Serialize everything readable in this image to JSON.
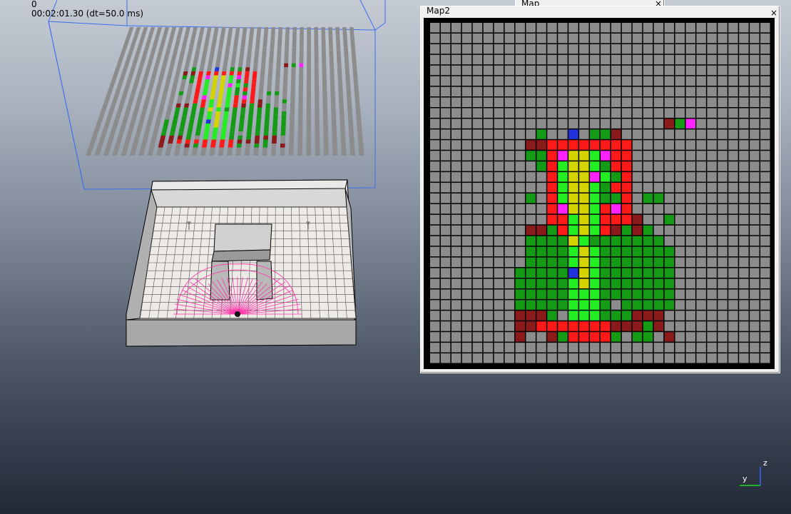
{
  "hud": {
    "frame": "0",
    "time": "00:02:01.30 (dt=50.0 ms)"
  },
  "windows": {
    "map": {
      "title": "Map",
      "close_label": "×"
    },
    "map2": {
      "title": "Map2",
      "close_label": "×"
    }
  },
  "axes_gizmo": {
    "y_label": "y",
    "z_label": "z"
  },
  "colors": {
    "unknown": "#8c8c8c",
    "darkred": "#8b1a1a",
    "red": "#ff1a1a",
    "orange": "#ff8c00",
    "yellow": "#d4d400",
    "lime": "#22ee22",
    "green": "#159a15",
    "blue": "#2233dd",
    "magenta": "#ff22ff",
    "grid_line": "#000000",
    "bounding_box": "#3a6ff0",
    "laser": "#ff33aa"
  },
  "map2": {
    "size": 32,
    "legend": {
      "u": "unknown",
      "d": "darkred",
      "r": "red",
      "o": "orange",
      "y": "yellow",
      "l": "lime",
      "g": "green",
      "b": "blue",
      "m": "magenta"
    },
    "rows": [
      "uuuuuuuuuuuuuuuuuuuuuuuuuuuuuuuu",
      "uuuuuuuuuuuuuuuuuuuuuuuuuuuuuuuu",
      "uuuuuuuuuuuuuuuuuuuuuuuuuuuuuuuu",
      "uuuuuuuuuuuuuuuuuuuuuuuuuuuuuuuu",
      "uuuuuuuuuuuuuuuuuuuuuuuuuuuuuuuu",
      "uuuuuuuuuuuuuuuuuuuuuuuuuuuuuuuu",
      "uuuuuuuuuuuuuuuuuuuuuuuuuuuuuuuu",
      "uuuuuuuuuuuuuuuuuuuuuuuuuuuuuuuu",
      "uuuuuuuuuuuuuuuuuuuuuuuuuuuuuuuu",
      "uuuuuuuuuuuuuuuuuuuuuudgmuuuuuuu",
      "uuuuuuuuuuguubuggduuuuuuuuuuuuuu",
      "uuuuuuuuuddrrrrrrrruuuuuuuuuuuuu",
      "uuuuuuuuuggrmyylmrruuuuuuuuuuuuu",
      "uuuuuuuuuugrlyylgrruuuuuuuuuuuuu",
      "uuuuuuuuuuurlyymlgruuuuuuuuuuuuu",
      "uuuuuuuuuuurlyylgrruuuuuuuuuuuuu",
      "uuuuuuuuugurlyylggrugguuuuuuuuuu",
      "uuuuuuuuuuurmyylrmruuuuuuuuuuuuu",
      "uuuuuuuuuuurrlylrrrduuguuuuuuuuu",
      "uuuuuuuuuddgrlylrdgdguuuuuuuuuuu",
      "uuuuuuuuuggggylggggggguuuuuuuuuu",
      "uuuuuuuuugggglylggggggguuuuuuuuu",
      "uuuuuuuuugggglylggggggguuuuuuuuu",
      "uuuuuuuugggggbylggggggguuuuuuuuu",
      "uuuuuuuuggggglylggggggguuuuuuuuu",
      "uuuuuuuuggggglllggggggguuuuuuuuu",
      "uuuuuuuuggggglllguggggguuuuuuuuu",
      "uuuuuuuudddgulllgggddduuuuuuuuuu",
      "uuuuuuuuddrrrrrrrdddgduuuuuuuuuu",
      "uuuuuuuuduudgrrrrgugguduuuuuuuuu",
      "uuuuuuuuuuuuuuuuuuuuuuuuuuuuuuuu",
      "uuuuuuuuuuuuuuuuuuuuuuuuuuuuuuuu"
    ]
  }
}
